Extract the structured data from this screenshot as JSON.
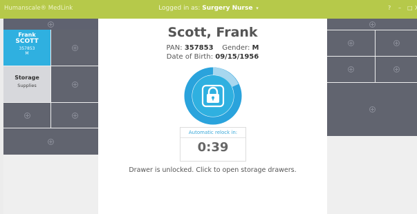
{
  "titlebar": {
    "app_name": "Humanscale® MedLink",
    "logged_in_prefix": "Logged in as:",
    "user": "Surgery Nurse",
    "caret": "▾",
    "help": "?",
    "minimize": "–",
    "maximize": "□",
    "close": "X"
  },
  "left_panel": {
    "patient": {
      "first_name": "Frank",
      "last_name": "SCOTT",
      "pan": "357853",
      "gender": "M"
    },
    "storage": {
      "name": "Storage",
      "sub": "Supplies"
    }
  },
  "center": {
    "patient_name": "Scott, Frank",
    "pan_label": "PAN:",
    "pan_value": "357853",
    "gender_label": "Gender:",
    "gender_value": "M",
    "dob_label": "Date of Birth:",
    "dob_value": "09/15/1956",
    "relock_label": "Automatic relock in:",
    "relock_timer": "0:39",
    "status_message": "Drawer is unlocked. Click to open storage drawers."
  },
  "colors": {
    "titlebar": "#b6c94a",
    "accent_blue": "#2fb0e0",
    "drawer_dark": "#61646f"
  }
}
